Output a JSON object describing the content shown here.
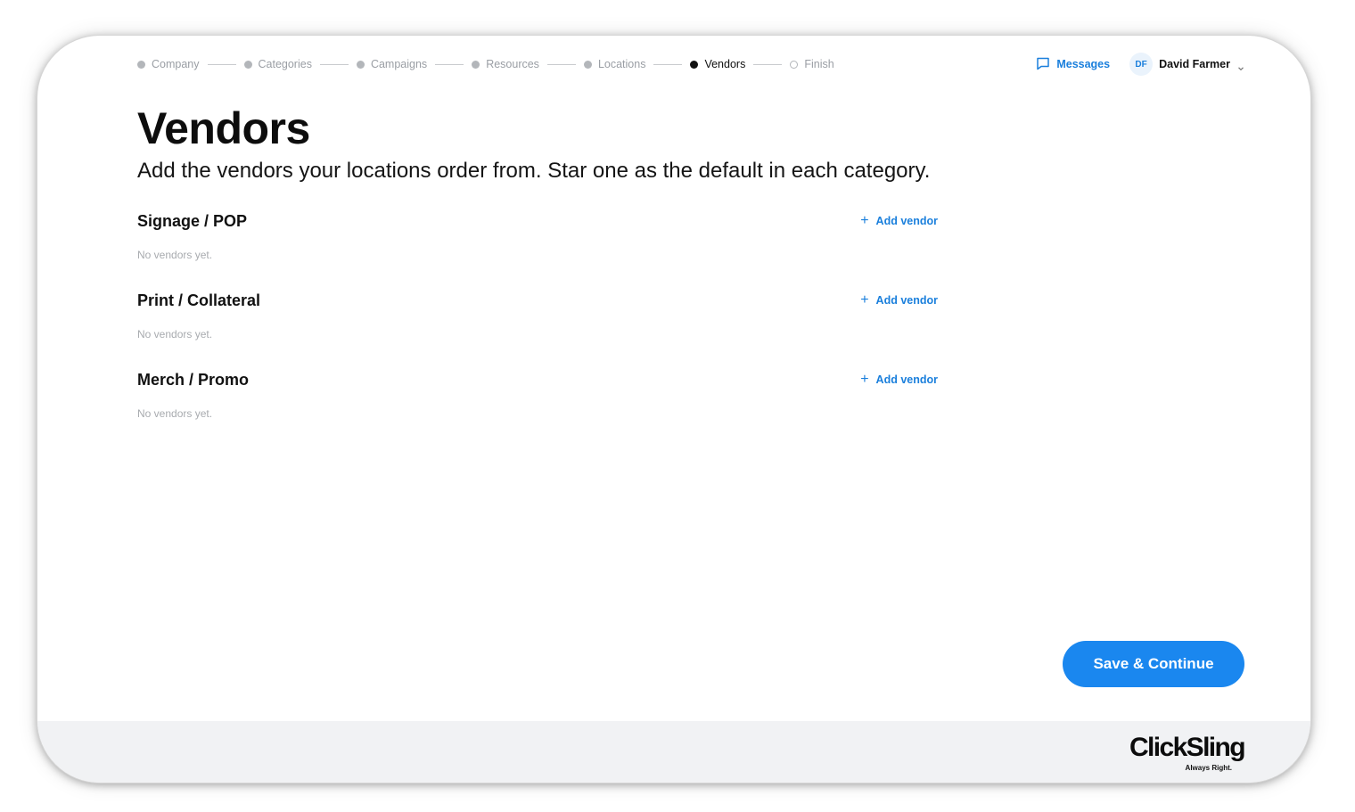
{
  "stepper": {
    "steps": [
      {
        "label": "Company",
        "state": "done"
      },
      {
        "label": "Categories",
        "state": "done"
      },
      {
        "label": "Campaigns",
        "state": "done"
      },
      {
        "label": "Resources",
        "state": "done"
      },
      {
        "label": "Locations",
        "state": "done"
      },
      {
        "label": "Vendors",
        "state": "active"
      },
      {
        "label": "Finish",
        "state": "pending"
      }
    ]
  },
  "header": {
    "messages_label": "Messages",
    "user": {
      "initials": "DF",
      "name": "David Farmer"
    }
  },
  "page": {
    "title": "Vendors",
    "subtitle": "Add the vendors your locations order from. Star one as the default in each category."
  },
  "sections": [
    {
      "title": "Signage / POP",
      "add_label": "Add vendor",
      "empty_text": "No vendors yet."
    },
    {
      "title": "Print / Collateral",
      "add_label": "Add vendor",
      "empty_text": "No vendors yet."
    },
    {
      "title": "Merch / Promo",
      "add_label": "Add vendor",
      "empty_text": "No vendors yet."
    }
  ],
  "actions": {
    "save_label": "Save & Continue"
  },
  "footer": {
    "logo_text": "ClickSling",
    "tagline": "Always Right."
  },
  "colors": {
    "accent": "#1a87ef",
    "link": "#1a7fdc",
    "footer_bg": "#f1f2f4",
    "muted": "#9a9ea4"
  },
  "icons": {
    "messages": "chat-bubble-icon",
    "user_menu": "chevron-down-icon",
    "add": "plus-icon"
  }
}
